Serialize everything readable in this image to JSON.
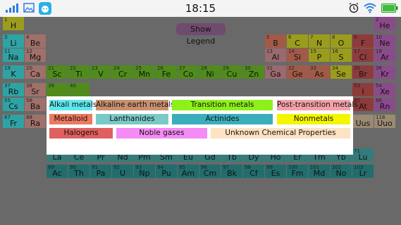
{
  "status_bar": {
    "time": "18:15",
    "icons": [
      "signal-icon",
      "gallery-icon",
      "cat-app-icon",
      "alarm-icon",
      "wifi-icon",
      "battery-icon"
    ]
  },
  "show_legend_label": "Show Legend",
  "colors": {
    "alkali": "#2fa3a3",
    "alkaline": "#a0706a",
    "transition": "#4f8c1c",
    "post_transition": "#9a6a6e",
    "metalloid": "#a25a47",
    "nonmetal": "#9c9c1c",
    "halogen": "#8f3b3b",
    "noble": "#8a4b8a",
    "lanthanide": "#357b7b",
    "actinide": "#216d6d",
    "unknown": "#9b8a72"
  },
  "elements": [
    {
      "n": "1",
      "s": "H",
      "c": "nonmetal"
    },
    {
      "n": "2",
      "s": "He",
      "c": "noble"
    },
    {
      "n": "3",
      "s": "Li",
      "c": "alkali"
    },
    {
      "n": "4",
      "s": "Be",
      "c": "alkaline"
    },
    {
      "n": "5",
      "s": "B",
      "c": "metalloid"
    },
    {
      "n": "6",
      "s": "C",
      "c": "nonmetal"
    },
    {
      "n": "7",
      "s": "N",
      "c": "nonmetal"
    },
    {
      "n": "8",
      "s": "O",
      "c": "nonmetal"
    },
    {
      "n": "9",
      "s": "F",
      "c": "halogen"
    },
    {
      "n": "10",
      "s": "Ne",
      "c": "noble"
    },
    {
      "n": "11",
      "s": "Na",
      "c": "alkali"
    },
    {
      "n": "12",
      "s": "Mg",
      "c": "alkaline"
    },
    {
      "n": "13",
      "s": "Al",
      "c": "post_transition"
    },
    {
      "n": "14",
      "s": "Si",
      "c": "metalloid"
    },
    {
      "n": "15",
      "s": "P",
      "c": "nonmetal"
    },
    {
      "n": "16",
      "s": "S",
      "c": "nonmetal"
    },
    {
      "n": "17",
      "s": "Cl",
      "c": "halogen"
    },
    {
      "n": "18",
      "s": "Ar",
      "c": "noble"
    },
    {
      "n": "19",
      "s": "K",
      "c": "alkali"
    },
    {
      "n": "20",
      "s": "Ca",
      "c": "alkaline"
    },
    {
      "n": "21",
      "s": "Sc",
      "c": "transition"
    },
    {
      "n": "22",
      "s": "Ti",
      "c": "transition"
    },
    {
      "n": "23",
      "s": "V",
      "c": "transition"
    },
    {
      "n": "24",
      "s": "Cr",
      "c": "transition"
    },
    {
      "n": "25",
      "s": "Mn",
      "c": "transition"
    },
    {
      "n": "26",
      "s": "Fe",
      "c": "transition"
    },
    {
      "n": "27",
      "s": "Co",
      "c": "transition"
    },
    {
      "n": "28",
      "s": "Ni",
      "c": "transition"
    },
    {
      "n": "29",
      "s": "Cu",
      "c": "transition"
    },
    {
      "n": "30",
      "s": "Zn",
      "c": "transition"
    },
    {
      "n": "31",
      "s": "Ga",
      "c": "post_transition"
    },
    {
      "n": "32",
      "s": "Ge",
      "c": "metalloid"
    },
    {
      "n": "33",
      "s": "As",
      "c": "metalloid"
    },
    {
      "n": "34",
      "s": "Se",
      "c": "nonmetal"
    },
    {
      "n": "35",
      "s": "Br",
      "c": "halogen"
    },
    {
      "n": "36",
      "s": "Kr",
      "c": "noble"
    },
    {
      "n": "37",
      "s": "Rb",
      "c": "alkali"
    },
    {
      "n": "38",
      "s": "Sr",
      "c": "alkaline"
    },
    {
      "n": "39",
      "s": "",
      "c": "transition"
    },
    {
      "n": "40",
      "s": "",
      "c": "transition"
    },
    {
      "n": "53",
      "s": "I",
      "c": "halogen"
    },
    {
      "n": "54",
      "s": "Xe",
      "c": "noble"
    },
    {
      "n": "55",
      "s": "Cs",
      "c": "alkali"
    },
    {
      "n": "56",
      "s": "Ba",
      "c": "alkaline"
    },
    {
      "n": "85",
      "s": "At",
      "c": "halogen"
    },
    {
      "n": "86",
      "s": "Rn",
      "c": "noble"
    },
    {
      "n": "87",
      "s": "Fr",
      "c": "alkali"
    },
    {
      "n": "88",
      "s": "Ra",
      "c": "alkaline"
    },
    {
      "n": "",
      "s": "Uus",
      "c": "unknown"
    },
    {
      "n": "118",
      "s": "Uuo",
      "c": "unknown"
    },
    {
      "n": "57",
      "s": "La",
      "c": "lanthanide"
    },
    {
      "n": "58",
      "s": "Ce",
      "c": "lanthanide"
    },
    {
      "n": "59",
      "s": "Pr",
      "c": "lanthanide"
    },
    {
      "n": "60",
      "s": "Nd",
      "c": "lanthanide"
    },
    {
      "n": "61",
      "s": "Pm",
      "c": "lanthanide"
    },
    {
      "n": "62",
      "s": "Sm",
      "c": "lanthanide"
    },
    {
      "n": "63",
      "s": "Eu",
      "c": "lanthanide"
    },
    {
      "n": "64",
      "s": "Gd",
      "c": "lanthanide"
    },
    {
      "n": "65",
      "s": "Tb",
      "c": "lanthanide"
    },
    {
      "n": "66",
      "s": "Dy",
      "c": "lanthanide"
    },
    {
      "n": "67",
      "s": "Ho",
      "c": "lanthanide"
    },
    {
      "n": "68",
      "s": "Er",
      "c": "lanthanide"
    },
    {
      "n": "69",
      "s": "Tm",
      "c": "lanthanide"
    },
    {
      "n": "70",
      "s": "Yb",
      "c": "lanthanide"
    },
    {
      "n": "71",
      "s": "Lu",
      "c": "lanthanide"
    },
    {
      "n": "89",
      "s": "Ac",
      "c": "actinide"
    },
    {
      "n": "90",
      "s": "Th",
      "c": "actinide"
    },
    {
      "n": "91",
      "s": "Pa",
      "c": "actinide"
    },
    {
      "n": "92",
      "s": "U",
      "c": "actinide"
    },
    {
      "n": "93",
      "s": "Np",
      "c": "actinide"
    },
    {
      "n": "94",
      "s": "Pu",
      "c": "actinide"
    },
    {
      "n": "95",
      "s": "Am",
      "c": "actinide"
    },
    {
      "n": "96",
      "s": "Cm",
      "c": "actinide"
    },
    {
      "n": "97",
      "s": "Bk",
      "c": "actinide"
    },
    {
      "n": "98",
      "s": "Cf",
      "c": "actinide"
    },
    {
      "n": "99",
      "s": "Es",
      "c": "actinide"
    },
    {
      "n": "100",
      "s": "Fm",
      "c": "actinide"
    },
    {
      "n": "101",
      "s": "Md",
      "c": "actinide"
    },
    {
      "n": "102",
      "s": "No",
      "c": "actinide"
    },
    {
      "n": "103",
      "s": "Lr",
      "c": "actinide"
    }
  ],
  "legend": {
    "items": [
      {
        "label": "Alkali metals",
        "color": "#5fe8ef"
      },
      {
        "label": "Alkaline earth metals",
        "color": "#c8906e"
      },
      {
        "label": "Transition metals",
        "color": "#8ef01a"
      },
      {
        "label": "Post-transition metals",
        "color": "#f3a1a8"
      },
      {
        "label": "Metalloid",
        "color": "#ee7860"
      },
      {
        "label": "Lanthanides",
        "color": "#79c9c9"
      },
      {
        "label": "Actinides",
        "color": "#3aaebb"
      },
      {
        "label": "Nonmetals",
        "color": "#f5f500"
      },
      {
        "label": "Halogens",
        "color": "#e06060"
      },
      {
        "label": "Noble gases",
        "color": "#f58cf5"
      },
      {
        "label": "Unknown Chemical Properties",
        "color": "#fde2c4"
      }
    ]
  }
}
